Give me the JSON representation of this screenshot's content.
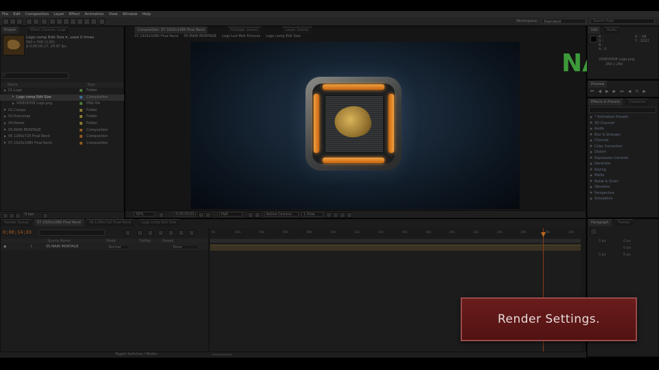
{
  "menu": [
    "File",
    "Edit",
    "Composition",
    "Layer",
    "Effect",
    "Animation",
    "View",
    "Window",
    "Help"
  ],
  "workspace": {
    "label": "Workspace:",
    "value": "Standard"
  },
  "search_help": {
    "placeholder": "Search Help"
  },
  "project_panel": {
    "tabs": [
      "Project",
      "Effect Controls: Logo"
    ],
    "selected_name": "Logo comp Edit Size ▾",
    "selected_info": [
      ", used 0 times",
      "560 x 500  (1.00)",
      "Δ 0;00;05;17, 29.97 fps"
    ],
    "columns": {
      "name": "Name",
      "type": "Type"
    },
    "bpc": "8 bpc",
    "items": [
      {
        "name": "01.Logo",
        "type": "Folder",
        "color": "#4a7a3a",
        "indent": 0,
        "expanded": true
      },
      {
        "name": "Logo comp Edit Size",
        "type": "Composition",
        "color": "#3a6a8a",
        "indent": 1,
        "selected": true
      },
      {
        "name": "VIDEOHIVE Logo.png",
        "type": "PNG file",
        "color": "#4a7a3a",
        "indent": 1
      },
      {
        "name": "02.Comps",
        "type": "Folder",
        "color": "#8a7a30",
        "indent": 0
      },
      {
        "name": "03.Precomps",
        "type": "Folder",
        "color": "#8a7a30",
        "indent": 0
      },
      {
        "name": "04.Needs",
        "type": "Folder",
        "color": "#8a7a30",
        "indent": 0
      },
      {
        "name": "05.MAIN MONTAGE",
        "type": "Composition",
        "color": "#8a5a20",
        "indent": 0
      },
      {
        "name": "06.1280x720 Final Rend",
        "type": "Composition",
        "color": "#8a5a20",
        "indent": 0
      },
      {
        "name": "07.1920x1080 Final Rend",
        "type": "Composition",
        "color": "#8a5a20",
        "indent": 0
      }
    ]
  },
  "comp_panel": {
    "tab": "Composition: 07.1920x1080 Final Rend",
    "other_tabs": [
      "Footage: (none)",
      "Layer: (none)"
    ],
    "breadcrumbs": [
      "07.1920x1080 Final Rend",
      "05.MAIN MONTAGE",
      "Logo Lod Mob Pictures",
      "Logo comp Edit Size"
    ],
    "bottom": {
      "zoom": "50%",
      "timecode": "0;00;03;01",
      "resolution": "Half",
      "view": "Active Camera",
      "views": "1 View"
    }
  },
  "info_panel": {
    "tabs": [
      "Info",
      "Audio"
    ],
    "r": "R :",
    "g": "G :",
    "b": "B :",
    "a": "A : 0",
    "x": "X : -58",
    "y": "Y : 1022",
    "file_label": "VIDEOHIVE Logo.png",
    "dims": "260 x 260"
  },
  "watermark": {
    "text": "NAD",
    "color_left": "#3d9a3a",
    "color_right": "#4a6aa0"
  },
  "preview_panel": {
    "tabs": [
      "Preview"
    ]
  },
  "effects_panel": {
    "tabs": [
      "Effects & Presets",
      "Character"
    ],
    "items": [
      "* Animation Presets",
      "3D Channel",
      "Audio",
      "Blur & Sharpen",
      "Channel",
      "Color Correction",
      "Distort",
      "Expression Controls",
      "Generate",
      "Keying",
      "Matte",
      "Noise & Grain",
      "Obsolete",
      "Perspective",
      "Simulation"
    ]
  },
  "paragraph_panel": {
    "tabs": [
      "Paragraph",
      "Tracker"
    ],
    "values": [
      "0 px",
      "0 px",
      "0 px",
      "0 px",
      "0 px"
    ]
  },
  "timeline": {
    "tabs": [
      "Render Queue",
      "07.1920x1080 Final Rend",
      "06.1280x720 Final Rend",
      "Logo comp Edit Size"
    ],
    "timecode": "0;00;14;03",
    "columns": {
      "source": "Source Name",
      "mode": "Mode",
      "trkmat": "TrkMat",
      "parent": "Parent"
    },
    "layer": {
      "number": "1",
      "name": "05.MAIN MONTAGE",
      "mode": "Normal",
      "parent": "None"
    },
    "ruler": [
      "0s",
      "02s",
      "04s",
      "06s",
      "08s",
      "10s",
      "12s",
      "14s",
      "16s",
      "18s",
      "20s",
      "22s",
      "24s",
      "26s",
      "28s",
      "30s"
    ],
    "toggle_label": "Toggle Switches / Modes"
  },
  "overlay": {
    "label": "Render Settings."
  }
}
